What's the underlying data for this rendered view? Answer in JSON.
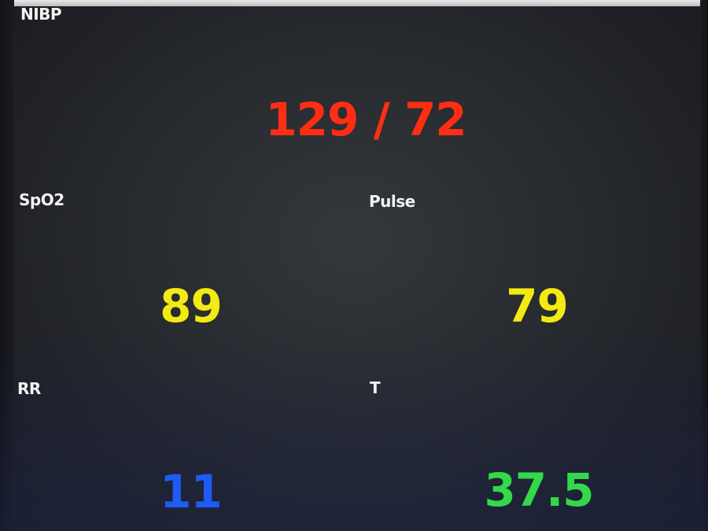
{
  "colors": {
    "nibp": "#ff2e12",
    "spo2": "#f3ea13",
    "pulse": "#f3ea13",
    "rr": "#1e5cf5",
    "temp": "#33d94a",
    "label": "#f2f2f2",
    "background": "#24272b"
  },
  "nibp": {
    "label": "NIBP",
    "value": "129 / 72"
  },
  "spo2": {
    "label": "SpO2",
    "value": "89"
  },
  "pulse": {
    "label": "Pulse",
    "value": "79"
  },
  "rr": {
    "label": "RR",
    "value": "11"
  },
  "temp": {
    "label": "T",
    "value": "37.5"
  }
}
